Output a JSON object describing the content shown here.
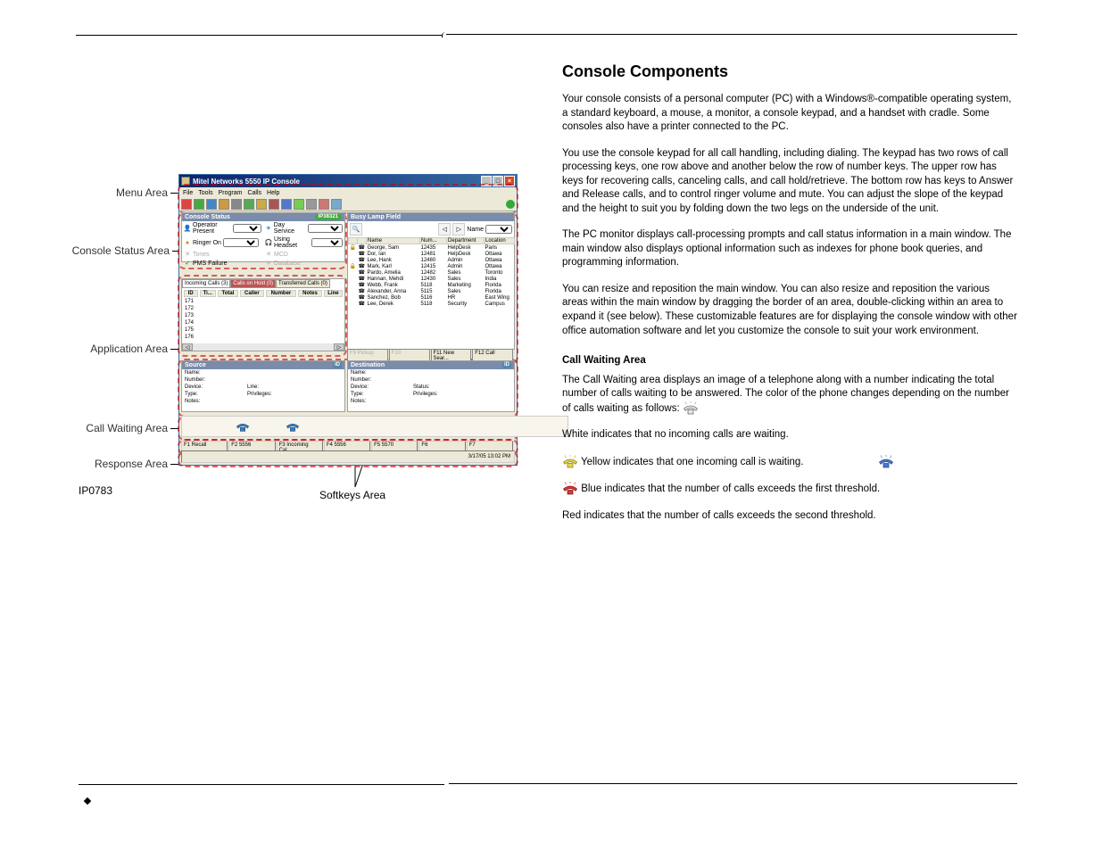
{
  "header": {
    "empty": ""
  },
  "annotations": {
    "menu": "Menu Area",
    "consoleStatus": "Console Status Area",
    "application": "Application Area",
    "callWaiting": "Call Waiting Area",
    "response": "Response Area",
    "softkeys": "Softkeys Area",
    "ipLabel": "IP0783"
  },
  "window": {
    "title": "Mitel Networks 5550 IP Console",
    "menus": [
      "File",
      "Tools",
      "Program",
      "Calls",
      "Help"
    ],
    "statusTag": "IP38321"
  },
  "consoleStatus": {
    "header": "Console Status",
    "rows": [
      [
        "Operator Present",
        "Day Service"
      ],
      [
        "Ringer On",
        "Using Headset"
      ],
      [
        "Tones",
        "MCD"
      ],
      [
        "PMS Failure",
        "Database"
      ]
    ]
  },
  "blf": {
    "header": "Busy Lamp Field",
    "searchLabel": "Name",
    "columns": [
      "",
      "",
      "Name",
      "Num...",
      "Department",
      "Location"
    ],
    "rows": [
      [
        "",
        "",
        "George, Sam",
        "12435",
        "HelpDesk",
        "Paris"
      ],
      [
        "",
        "",
        "Dor, Ian",
        "12481",
        "HelpDesk",
        "Ottawa"
      ],
      [
        "",
        "",
        "Lee, Hank",
        "12480",
        "Admin",
        "Ottawa"
      ],
      [
        "",
        "",
        "Mark, Karl",
        "12415",
        "Admin",
        "Ottawa"
      ],
      [
        "",
        "",
        "Pardo, Amelia",
        "12482",
        "Sales",
        "Toronto"
      ],
      [
        "",
        "",
        "Hannan, Mehdi",
        "12430",
        "Sales",
        "India"
      ],
      [
        "",
        "",
        "Webb, Frank",
        "5118",
        "Marketing",
        "Florida"
      ],
      [
        "",
        "",
        "Alexander, Anna",
        "5115",
        "Sales",
        "Florida"
      ],
      [
        "",
        "",
        "Sanchez, Bob",
        "5116",
        "HR",
        "East Wing"
      ],
      [
        "",
        "",
        "Lee, Derek",
        "5118",
        "Security",
        "Campus"
      ]
    ],
    "softkeys": [
      "F9 Pickup",
      "F10",
      "F11 New Sear...",
      "F12 Call"
    ]
  },
  "incoming": {
    "tabs": [
      "Incoming Calls (3)",
      "Calls on Hold (0)",
      "Transferred Calls (0)"
    ],
    "columns": [
      "ID",
      "Ti...",
      "Total",
      "Caller",
      "Number",
      "Notes",
      "Line"
    ],
    "rows": [
      "171",
      "172",
      "173",
      "174",
      "175",
      "176"
    ]
  },
  "source": {
    "header": "Source",
    "labels": {
      "name": "Name:",
      "number": "Number:",
      "device": "Device:",
      "line": "Line:",
      "type": "Type:",
      "priv": "Privileges:",
      "notes": "Notes:"
    }
  },
  "destination": {
    "header": "Destination",
    "labels": {
      "name": "Name:",
      "number": "Number:",
      "device": "Device:",
      "status": "Status:",
      "type": "Type:",
      "priv": "Privileges:",
      "notes": "Notes:"
    }
  },
  "fkeys": [
    "F1 Recall",
    "F2 5556",
    "F3 Incoming Cal...",
    "F4 5556",
    "F5 5570",
    "F6",
    "F7"
  ],
  "statusbar": "3/17/05 13:02 PM",
  "bodytext": {
    "title": "Console Components",
    "p1": "Your console consists of a personal computer (PC) with a Windows®-compatible operating system, a standard keyboard, a mouse, a monitor, a console keypad, and a handset with cradle. Some consoles also have a printer connected to the PC.",
    "p2": "You use the console keypad for all call handling, including dialing. The keypad has two rows of call processing keys, one row above and another below the row of number keys. The upper row has keys for recovering calls, canceling calls, and call hold/retrieve. The bottom row has keys to Answer and Release calls, and to control ringer volume and mute. You can adjust the slope of the keypad and the height to suit you by folding down the two legs on the underside of the unit.",
    "p3": "The PC monitor displays call-processing prompts and call status information in a main window. The main window also displays optional information such as indexes for phone book queries, and programming information.",
    "p4": "You can resize and reposition the main window. You can also resize and reposition the various areas within the main window by dragging the border of an area, double-clicking within an area to expand it (see below). These customizable features are for displaying the console window with other office automation software and let you customize the console to suit your work environment.",
    "h_cwa": "Call Waiting Area",
    "cwa_p": "The Call Waiting area displays an image of a telephone along with a number indicating the total number of calls waiting to be answered. The color of the phone changes depending on the number of calls waiting as follows:",
    "cwa_b1a": "White",
    "cwa_b1b": " indicates that no incoming calls are waiting.",
    "cwa_b2a": "Yellow",
    "cwa_b2b": " indicates that one incoming call is waiting.",
    "cwa_b3a": "Blue",
    "cwa_b3b": " indicates that the number of calls exceeds the first threshold.",
    "cwa_b4a": "Red",
    "cwa_b4b": " indicates that the number of calls exceeds the second threshold."
  }
}
